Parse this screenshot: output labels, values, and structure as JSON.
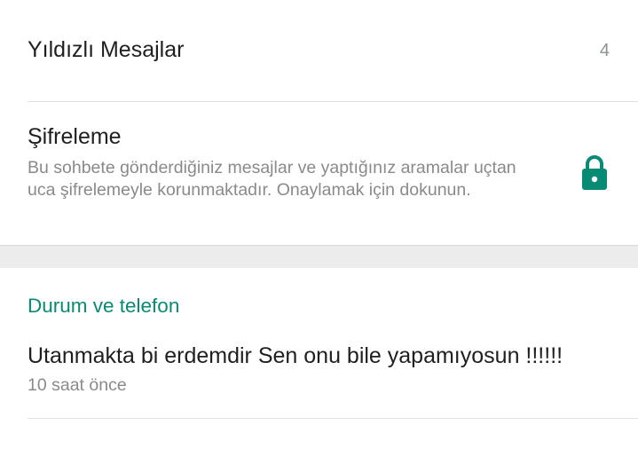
{
  "starred": {
    "label": "Yıldızlı Mesajlar",
    "count": "4"
  },
  "encryption": {
    "title": "Şifreleme",
    "description": "Bu sohbete gönderdiğiniz mesajlar ve yaptığınız aramalar uçtan uca şifrelemeyle korunmaktadır. Onaylamak için dokunun.",
    "icon": "lock-icon"
  },
  "status_section": {
    "header": "Durum ve telefon",
    "status_text": "Utanmakta bi erdemdir Sen onu bile yapamıyosun !!!!!!",
    "status_time": "10 saat önce"
  },
  "colors": {
    "accent": "#078b75",
    "primary_text": "#1f1f1f",
    "secondary_text": "#8a8a8a",
    "separator": "#ececec"
  }
}
